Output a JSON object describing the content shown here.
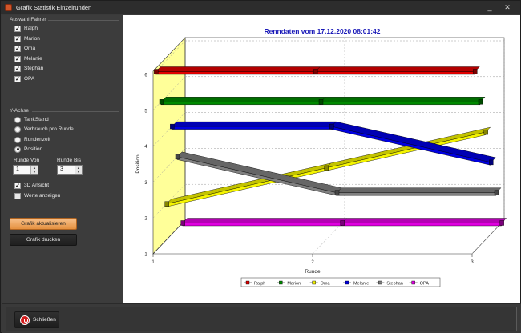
{
  "window": {
    "title": "Grafik Statistik Einzelrunden",
    "min_label": "_",
    "close_label": "✕"
  },
  "drivers_group": {
    "title": "Auswahl Fahrer",
    "items": [
      {
        "label": "Ralph",
        "checked": true
      },
      {
        "label": "Marion",
        "checked": true
      },
      {
        "label": "Oma",
        "checked": true
      },
      {
        "label": "Melanie",
        "checked": true
      },
      {
        "label": "Stephan",
        "checked": true
      },
      {
        "label": "OPA",
        "checked": true
      }
    ]
  },
  "y_axis_group": {
    "title": "Y-Achse",
    "options": [
      {
        "label": "TankStand",
        "selected": false
      },
      {
        "label": "Verbrauch pro Runde",
        "selected": false
      },
      {
        "label": "Rundenzeit",
        "selected": false
      },
      {
        "label": "Position",
        "selected": true
      }
    ]
  },
  "range": {
    "from_label": "Runde Von",
    "from_value": "1",
    "to_label": "Runde Bis",
    "to_value": "3"
  },
  "options": {
    "view3d_label": "3D Ansicht",
    "view3d_checked": true,
    "show_values_label": "Werte anzeigen",
    "show_values_checked": false
  },
  "buttons": {
    "update": "Grafik aktualisieren",
    "print": "Grafik drucken",
    "close": "Schließen"
  },
  "chart_data": {
    "type": "line",
    "title": "Renndaten vom 17.12.2020 08:01:42",
    "xlabel": "Runde",
    "ylabel": "Position",
    "x": [
      1,
      2,
      3
    ],
    "x_ticks": [
      "1",
      "2",
      "3"
    ],
    "y_ticks": [
      "1",
      "2",
      "3",
      "4",
      "5",
      "6"
    ],
    "ylim": [
      1,
      6
    ],
    "grid": true,
    "three_d": true,
    "legend_position": "bottom",
    "series": [
      {
        "name": "Ralph",
        "color": "#e00000",
        "values": [
          6,
          6,
          6
        ]
      },
      {
        "name": "Marion",
        "color": "#008a00",
        "values": [
          5,
          5,
          5
        ]
      },
      {
        "name": "Oma",
        "color": "#f4f400",
        "values": [
          2,
          3,
          4
        ]
      },
      {
        "name": "Melanie",
        "color": "#0000e0",
        "values": [
          4,
          4,
          3
        ]
      },
      {
        "name": "Stephan",
        "color": "#808080",
        "values": [
          3,
          2,
          2
        ]
      },
      {
        "name": "OPA",
        "color": "#e000e0",
        "values": [
          1,
          1,
          1
        ]
      }
    ]
  }
}
